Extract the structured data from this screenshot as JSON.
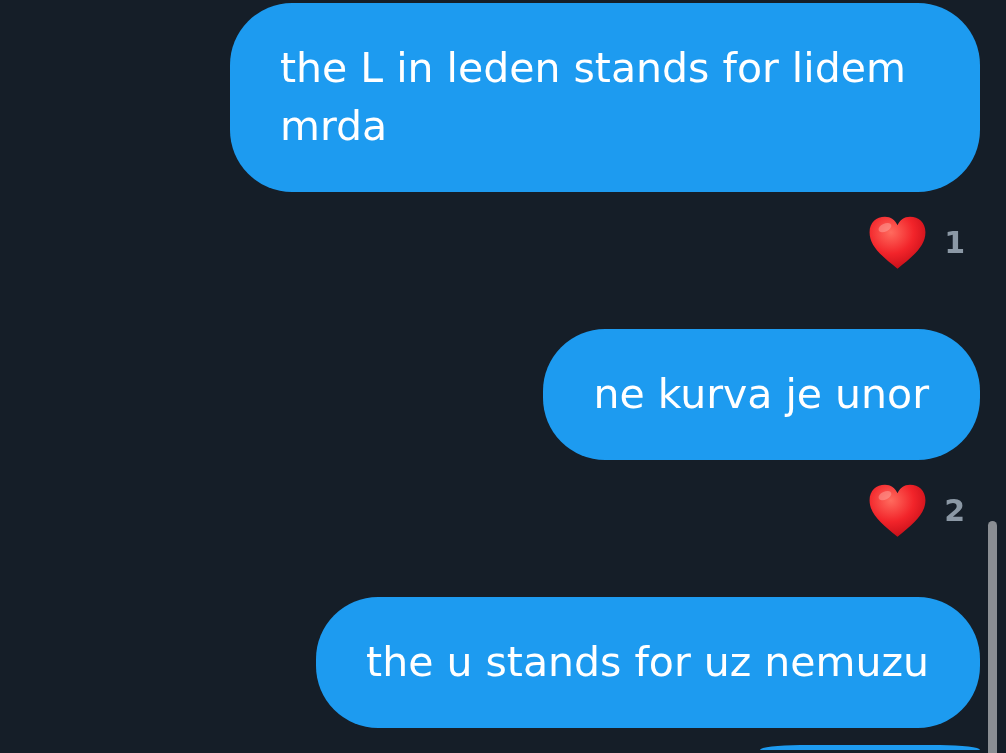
{
  "messages": [
    {
      "kind": "text",
      "text": "the L in leden stands for lidem mrda",
      "reaction": {
        "count": "1"
      }
    },
    {
      "kind": "text",
      "text": "ne kurva je unor",
      "reaction": {
        "count": "2"
      }
    },
    {
      "kind": "text",
      "text": "the u stands for uz nemuzu"
    },
    {
      "kind": "cut_off"
    }
  ]
}
